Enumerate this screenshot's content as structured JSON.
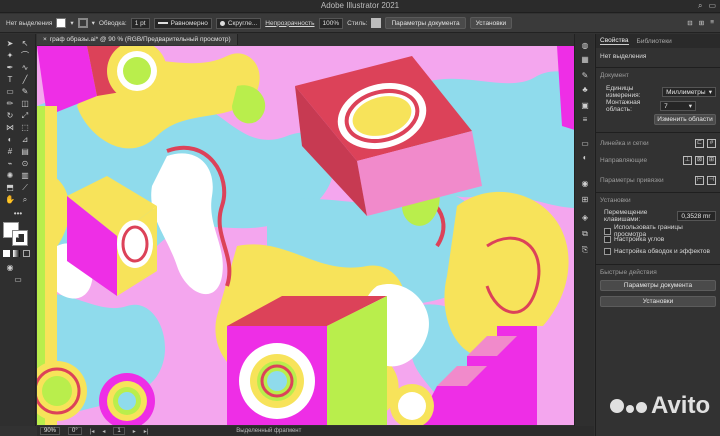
{
  "app": {
    "title": "Adobe Illustrator 2021"
  },
  "controlbar": {
    "selection_label": "Нет выделения",
    "stroke_label": "Обводка:",
    "stroke_value": "1 pt",
    "profile_value": "Равномерно",
    "brush_value": "Скругле...",
    "opacity_label": "Непрозрачность",
    "opacity_value": "100%",
    "style_label": "Стиль:",
    "doc_params_button": "Параметры документа",
    "settings_button": "Установки"
  },
  "document": {
    "tab_label": "граф образы.ai* @ 90 % (RGB/Предварительный просмотр)"
  },
  "status": {
    "zoom": "90%",
    "rotation": "0°",
    "artboard": "1",
    "selection_info": "Выделенный фрагмент"
  },
  "panel": {
    "tab_properties": "Свойства",
    "tab_libraries": "Библиотеки",
    "no_selection": "Нет выделения",
    "document_header": "Документ",
    "units_label": "Единицы измерения:",
    "units_value": "Миллиметры",
    "artboard_label": "Монтажная область:",
    "artboard_value": "7",
    "edit_artboards_button": "Изменить области",
    "rulers_grids_header": "Линейка и сетки",
    "guides_header": "Направляющие",
    "snap_options_header": "Параметры привязки",
    "settings_header": "Установки",
    "keyboard_increment_label": "Перемещение клавишами:",
    "keyboard_increment_value": "0,3528 mr",
    "option_preview_bounds": "Использовать границы просмотра",
    "option_corner_scale": "Настройка углов",
    "option_scale_strokes": "Настройка обводок и эффектов",
    "quick_actions_header": "Быстрые действия",
    "doc_params_button": "Параметры документа",
    "settings_button": "Установки"
  },
  "watermark": {
    "text": "Avito"
  },
  "colors": {
    "magenta": "#ee2ee6",
    "pink": "#f4a6ee",
    "yellow": "#f7e35a",
    "cyan": "#8fdbec",
    "red": "#dc4259",
    "lime": "#b9ee4c",
    "white": "#ffffff"
  }
}
